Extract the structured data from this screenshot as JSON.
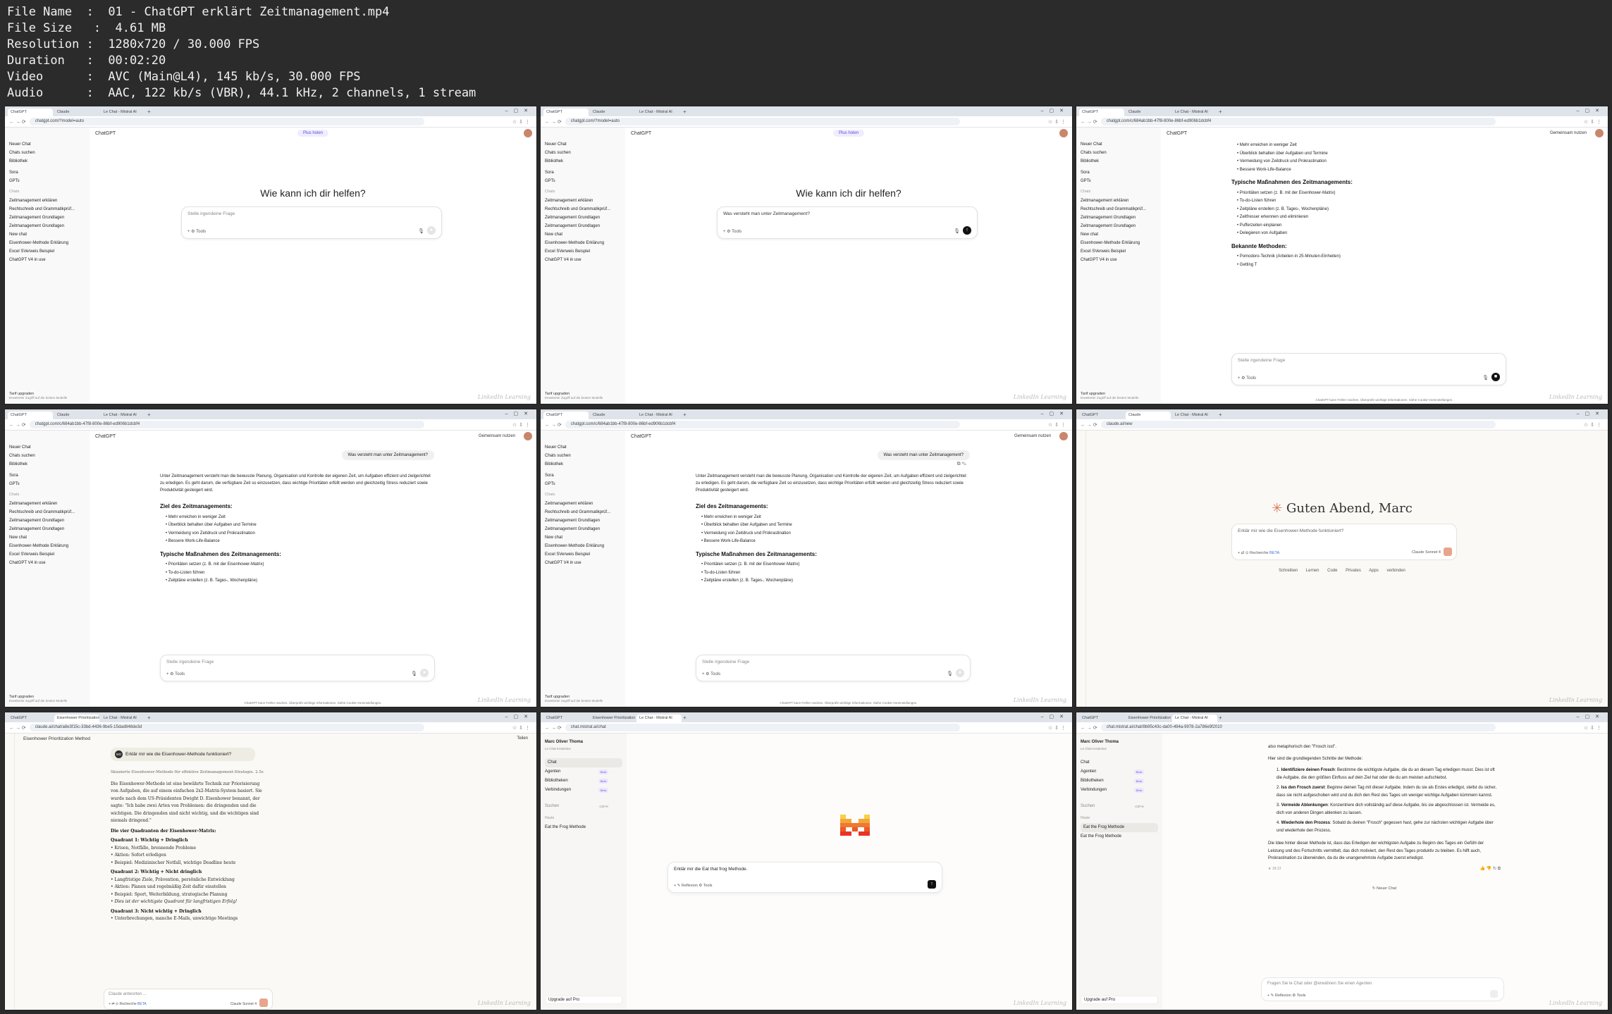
{
  "meta": {
    "file_name": "01 - ChatGPT erklärt Zeitmanagement.mp4",
    "file_size": "4.61 MB",
    "resolution": "1280x720 / 30.000 FPS",
    "duration": "00:02:20",
    "video": "AVC (Main@L4), 145 kb/s, 30.000 FPS",
    "audio": "AAC, 122 kb/s (VBR), 44.1 kHz, 2 channels, 1 stream",
    "labels": {
      "file_name": "File Name",
      "file_size": "File Size",
      "resolution": "Resolution",
      "duration": "Duration",
      "video": "Video",
      "audio": "Audio"
    }
  },
  "watermark": "LinkedIn Learning",
  "chatgpt": {
    "tabs": [
      "ChatGPT",
      "Claude",
      "Le Chat - Mistral AI"
    ],
    "url_home": "chatgpt.com/?model=auto",
    "url_chat": "chatgpt.com/c/684ab1bb-47f8-800e-86bf-ed906b1dcbf4",
    "model": "ChatGPT",
    "plus": "Plus holen",
    "share": "Gemeinsam nutzen",
    "nav": [
      "Neuer Chat",
      "Chats suchen",
      "Bibliothek",
      "Sora",
      "GPTs"
    ],
    "chats_heading": "Chats",
    "chats": [
      "Zeitmanagement erklären",
      "Rechtschreib und Grammatikprüf...",
      "Zeitmanagement Grundlagen",
      "Zeitmanagement Grundlagen",
      "New chat",
      "Eisenhower-Methode Erklärung",
      "Excel SVerweis Beispiel",
      "ChatGPT V4 in use"
    ],
    "upgrade": "Tarif upgraden",
    "upgrade_sub": "Erweiterter Zugriff auf die besten Modelle",
    "greeting": "Wie kann ich dir helfen?",
    "placeholder": "Stelle irgendeine Frage",
    "typed": "Was versteht man unter Zeitmanagement?",
    "tools": "Tools",
    "disclaimer": "ChatGPT kann Fehler machen. Überprüfe wichtige Informationen. Siehe Cookie-Voreinstellungen.",
    "question": "Was versteht man unter Zeitmanagement?",
    "answer_intro": "Unter Zeitmanagement versteht man die bewusste Planung, Organisation und Kontrolle der eigenen Zeit, um Aufgaben effizient und zielgerichtet zu erledigen. Es geht darum, die verfügbare Zeit so einzusetzen, dass wichtige Prioritäten erfüllt werden und gleichzeitig Stress reduziert sowie Produktivität gesteigert wird.",
    "h_ziel": "Ziel des Zeitmanagements:",
    "ziel": [
      "Mehr erreichen in weniger Zeit",
      "Überblick behalten über Aufgaben und Termine",
      "Vermeidung von Zeitdruck und Prokrastination",
      "Bessere Work-Life-Balance"
    ],
    "h_mass": "Typische Maßnahmen des Zeitmanagements:",
    "mass": [
      "Prioritäten setzen (z. B. mit der Eisenhower-Matrix)",
      "To-do-Listen führen",
      "Zeitpläne erstellen (z. B. Tages-, Wochenpläne)",
      "Zeitfresser erkennen und eliminieren",
      "Pufferzeiten einplanen",
      "Delegieren von Aufgaben"
    ],
    "h_meth": "Bekannte Methoden:",
    "meth": [
      "Pomodoro-Technik (Arbeiten in 25-Minuten-Einheiten)",
      "Getting T"
    ]
  },
  "claude": {
    "url_new": "claude.ai/new",
    "url_chat": "claude.ai/chat/a8e3f15c-33bd-4436-9be5-15dad848de3d",
    "greeting_prefix": "✳",
    "greeting": "Guten Abend, Marc",
    "composer_text": "Erklär mir wie die Eisenhower-Methode funktioniert?",
    "research": "Recherche",
    "beta": "BETA",
    "model": "Claude Sonnet 4",
    "actions": [
      "Schreiben",
      "Lernen",
      "Code",
      "Privates",
      "Apps verbinden"
    ],
    "chat_title": "Eisenhower Prioritization Method",
    "share": "Teilen",
    "user_q": "Erklär mir wie die Eisenhower-Methode funktioniert?",
    "thinking": "Skizzierte Eisenhower-Methode für effektive Zeitmanagement-Strategie.",
    "thinking_time": "2.5s",
    "answer_intro": "Die Eisenhower-Methode ist eine bewährte Technik zur Priorisierung von Aufgaben, die auf einem einfachen 2x2-Matrix-System basiert. Sie wurde nach dem US-Präsidenten Dwight D. Eisenhower benannt, der sagte: \"Ich habe zwei Arten von Problemen: die dringenden und die wichtigen. Die dringenden sind nicht wichtig, und die wichtigen sind niemals dringend.\"",
    "h_quad": "Die vier Quadranten der Eisenhower-Matrix:",
    "q1": "Quadrant 1: Wichtig + Dringlich",
    "q1_items": [
      "Krisen, Notfälle, brennende Probleme",
      "Aktion: Sofort erledigen",
      "Beispiel: Medizinischer Notfall, wichtige Deadline heute"
    ],
    "q2": "Quadrant 2: Wichtig + Nicht dringlich",
    "q2_items": [
      "Langfristige Ziele, Prävention, persönliche Entwicklung",
      "Aktion: Planen und regelmäßig Zeit dafür einstellen",
      "Beispiel: Sport, Weiterbildung, strategische Planung",
      "Dies ist der wichtigste Quadrant für langfristigen Erfolg!"
    ],
    "q3": "Quadrant 3: Nicht wichtig + Dringlich",
    "q3_items": [
      "Unterbrechungen, manche E-Mails, unwichtige Meetings"
    ],
    "reply_placeholder": "Claude antworten ...",
    "avatar": "MO"
  },
  "mistral": {
    "url_new": "chat.mistral.ai/chat",
    "url_chat": "chat.mistral.ai/chat/8b95c43c-da00-494a-9978-2a786e9f2010",
    "user": "Marc Oliver Thoma",
    "plan": "Le Chat Kostenlos",
    "nav": [
      "Chat",
      "Agenten",
      "Bibliotheken",
      "Verbindungen"
    ],
    "beta": "Beta",
    "search": "Suchen",
    "search_kbd": "Ctrl+K",
    "today": "Heute",
    "history": [
      "Eat the Frog Methode",
      "Eat the Frog Methode"
    ],
    "upgrade": "Upgrade auf Pro",
    "composer_text": "Erklär mir die Eat that frog Methode.",
    "reflexion": "Reflexion",
    "tools": "Tools",
    "placeholder": "Fragen Sie le Chat oder @erwähnen Sie einen Agenten",
    "new_chat": "Neuer Chat",
    "answer_top": "also metaphorisch den \"Frosch isst\".",
    "answer_lead": "Hier sind die grundlegenden Schritte der Methode:",
    "steps": [
      {
        "t": "Identifiziere deinen Frosch",
        "d": ": Bestimme die wichtigste Aufgabe, die du an diesem Tag erledigen musst. Dies ist oft die Aufgabe, die den größten Einfluss auf dein Ziel hat oder die du am meisten aufschiebst."
      },
      {
        "t": "Iss den Frosch zuerst",
        "d": ": Beginne deinen Tag mit dieser Aufgabe. Indem du sie als Erstes erledigst, stellst du sicher, dass sie nicht aufgeschoben wird und du dich den Rest des Tages um weniger wichtige Aufgaben kümmern kannst."
      },
      {
        "t": "Vermeide Ablenkungen",
        "d": ": Konzentriere dich vollständig auf diese Aufgabe, bis sie abgeschlossen ist. Vermeide es, dich von anderen Dingen ablenken zu lassen."
      },
      {
        "t": "Wiederhole den Prozess",
        "d": ": Sobald du deinen \"Frosch\" gegessen hast, gehe zur nächsten wichtigen Aufgabe über und wiederhole den Prozess."
      }
    ],
    "answer_outro": "Die Idee hinter dieser Methode ist, dass das Erledigen der wichtigsten Aufgabe zu Beginn des Tages ein Gefühl der Leistung und des Fortschritts vermittelt, das dich motiviert, den Rest des Tages produktiv zu bleiben. Es hilft auch, Prokrastination zu überwinden, da du die unangenehmste Aufgabe zuerst erledigst.",
    "time": "18:13",
    "brand_colors": [
      "#f7d046",
      "#f2a73b",
      "#ee792f",
      "#eb5829",
      "#ea3326"
    ]
  }
}
